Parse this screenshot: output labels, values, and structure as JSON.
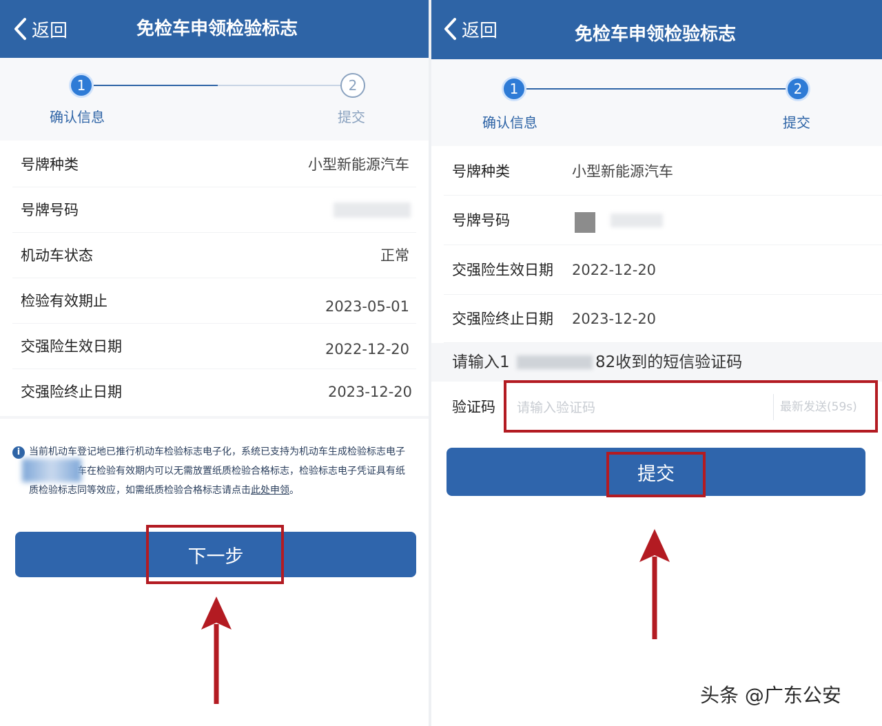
{
  "left": {
    "nav": {
      "back_label": "返回",
      "title": "免检车申领检验标志"
    },
    "steps": [
      {
        "number": "1",
        "label": "确认信息",
        "state": "active"
      },
      {
        "number": "2",
        "label": "提交",
        "state": "pending"
      }
    ],
    "rows": [
      {
        "label": "号牌种类",
        "value": "小型新能源汽车"
      },
      {
        "label": "号牌号码",
        "value": ""
      },
      {
        "label": "机动车状态",
        "value": "正常"
      },
      {
        "label": "检验有效期止",
        "value": "2023-05-01"
      },
      {
        "label": "交强险生效日期",
        "value": "2022-12-20"
      },
      {
        "label": "交强险终止日期",
        "value": "2023-12-20"
      }
    ],
    "notice": {
      "text": "当前机动车登记地已推行机动车检验标志电子化，系统已支持为机动车生成检验标志电子凭证，机动车在检验有效期内可以无需放置纸质检验合格标志，检验标志电子凭证具有纸质检验标志同等效应，如需纸质检验合格标志请点击",
      "link": "此处申领",
      "end": "。"
    },
    "next_button": "下一步"
  },
  "right": {
    "nav": {
      "back_label": "返回",
      "title": "免检车申领检验标志"
    },
    "steps": [
      {
        "number": "1",
        "label": "确认信息",
        "state": "done"
      },
      {
        "number": "2",
        "label": "提交",
        "state": "active"
      }
    ],
    "rows": [
      {
        "label": "号牌种类",
        "value": "小型新能源汽车"
      },
      {
        "label": "号牌号码",
        "value": ""
      },
      {
        "label": "交强险生效日期",
        "value": "2022-12-20"
      },
      {
        "label": "交强险终止日期",
        "value": "2023-12-20"
      }
    ],
    "sms_prompt": {
      "prefix": "请输入1",
      "suffix": "82收到的短信验证码"
    },
    "code_field": {
      "label": "验证码",
      "placeholder": "请输入验证码",
      "resend": "最新发送(59s)"
    },
    "submit_button": "提交"
  },
  "watermark": "头条 @广东公安",
  "colors": {
    "nav_bg": "#2e64a6",
    "button_bg": "#2f65ac",
    "highlight": "#b31b22",
    "step_active": "#2e7bd6"
  }
}
